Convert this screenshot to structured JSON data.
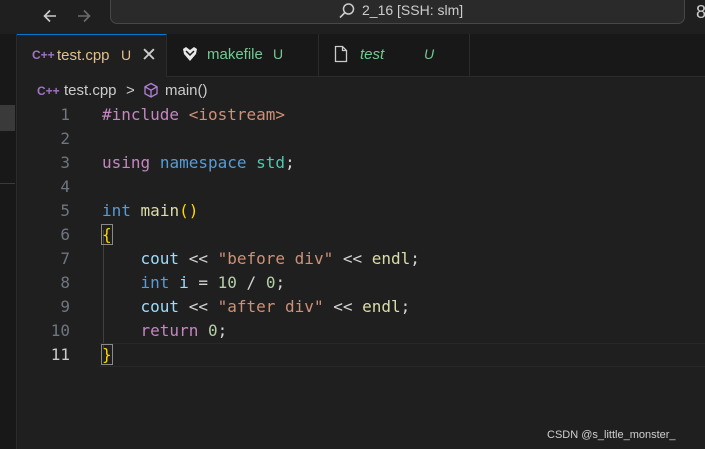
{
  "titlebar": {
    "back_icon": "arrow-left-icon",
    "forward_icon": "arrow-right-icon",
    "search_text": "2_16 [SSH: slm]",
    "right_glyph": "8"
  },
  "tabs": [
    {
      "icon": "C++",
      "label": "test.cpp",
      "status": "U",
      "close": "✕",
      "label_color": "#e2c08d"
    },
    {
      "icon": "makefile-icon",
      "label": "makefile",
      "status": "U",
      "label_color": "#73c991"
    },
    {
      "icon": "file-icon",
      "label": "test",
      "status": "U",
      "label_color": "#73c991"
    }
  ],
  "breadcrumb": {
    "file_icon": "C++",
    "file": "test.cpp",
    "separator": ">",
    "symbol_icon": "cube-icon",
    "symbol": "main()"
  },
  "code": {
    "line_numbers": [
      "1",
      "2",
      "3",
      "4",
      "5",
      "6",
      "7",
      "8",
      "9",
      "10",
      "11"
    ],
    "l1_kw": "#include",
    "l1_header": "<iostream>",
    "l3_using": "using",
    "l3_namespace": "namespace",
    "l3_std": "std",
    "l3_semi": ";",
    "l5_int": "int",
    "l5_main": "main",
    "l5_parens": "()",
    "l6_brace": "{",
    "l7_cout": "cout",
    "l7_op1": "<<",
    "l7_str": "\"before div\"",
    "l7_op2": "<<",
    "l7_endl": "endl",
    "l7_semi": ";",
    "l8_int": "int",
    "l8_i": "i",
    "l8_eq": "=",
    "l8_num1": "10",
    "l8_div": "/",
    "l8_num2": "0",
    "l8_semi": ";",
    "l9_cout": "cout",
    "l9_op1": "<<",
    "l9_str": "\"after div\"",
    "l9_op2": "<<",
    "l9_endl": "endl",
    "l9_semi": ";",
    "l10_return": "return",
    "l10_num": "0",
    "l10_semi": ";",
    "l11_brace": "}"
  },
  "watermark": "CSDN @s_little_monster_"
}
